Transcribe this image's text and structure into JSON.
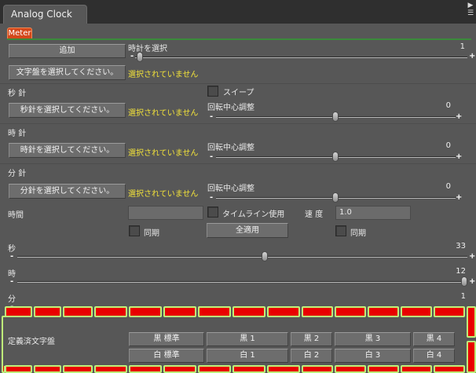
{
  "window": {
    "title": "Analog Clock"
  },
  "meter_tab": {
    "label": "Meter"
  },
  "add": {
    "label": "追加",
    "select_clock_label": "時計を選択",
    "value": "1"
  },
  "face": {
    "button": "文字盤を選択してください。",
    "status": "選択されていません"
  },
  "second_hand": {
    "title": "秒 針",
    "sweep": "スイープ",
    "button": "秒針を選択してください。",
    "status": "選択されていません",
    "center_label": "回転中心調整",
    "value": "0"
  },
  "hour_hand": {
    "title": "時 針",
    "button": "時針を選択してください。",
    "status": "選択されていません",
    "center_label": "回転中心調整",
    "value": "0"
  },
  "minute_hand": {
    "title": "分 針",
    "button": "分針を選択してください。",
    "status": "選択されていません",
    "center_label": "回転中心調整",
    "value": "0"
  },
  "time": {
    "label": "時間",
    "timeline": "タイムライン使用",
    "speed_label": "速 度",
    "speed_value": "1.0",
    "sync": "同期",
    "apply_all": "全適用",
    "sync2": "同期"
  },
  "sliders": {
    "seconds": {
      "label": "秒",
      "value": "33",
      "fraction": 0.55
    },
    "hours": {
      "label": "時",
      "value": "12",
      "fraction": 1.0
    },
    "minutes": {
      "label": "分",
      "value": "1"
    }
  },
  "presets": {
    "label": "定義済文字盤",
    "row1": [
      "黒 標準",
      "黒 1",
      "黒 2",
      "黒 3",
      "黒 4"
    ],
    "row2": [
      "白 標準",
      "白 1",
      "白 2",
      "白 3",
      "白 4"
    ]
  },
  "colors": {
    "accent_tab": "#d4481b",
    "status_text": "#f2e23a",
    "highlight_red": "#e90000",
    "highlight_green": "#bff27a"
  }
}
